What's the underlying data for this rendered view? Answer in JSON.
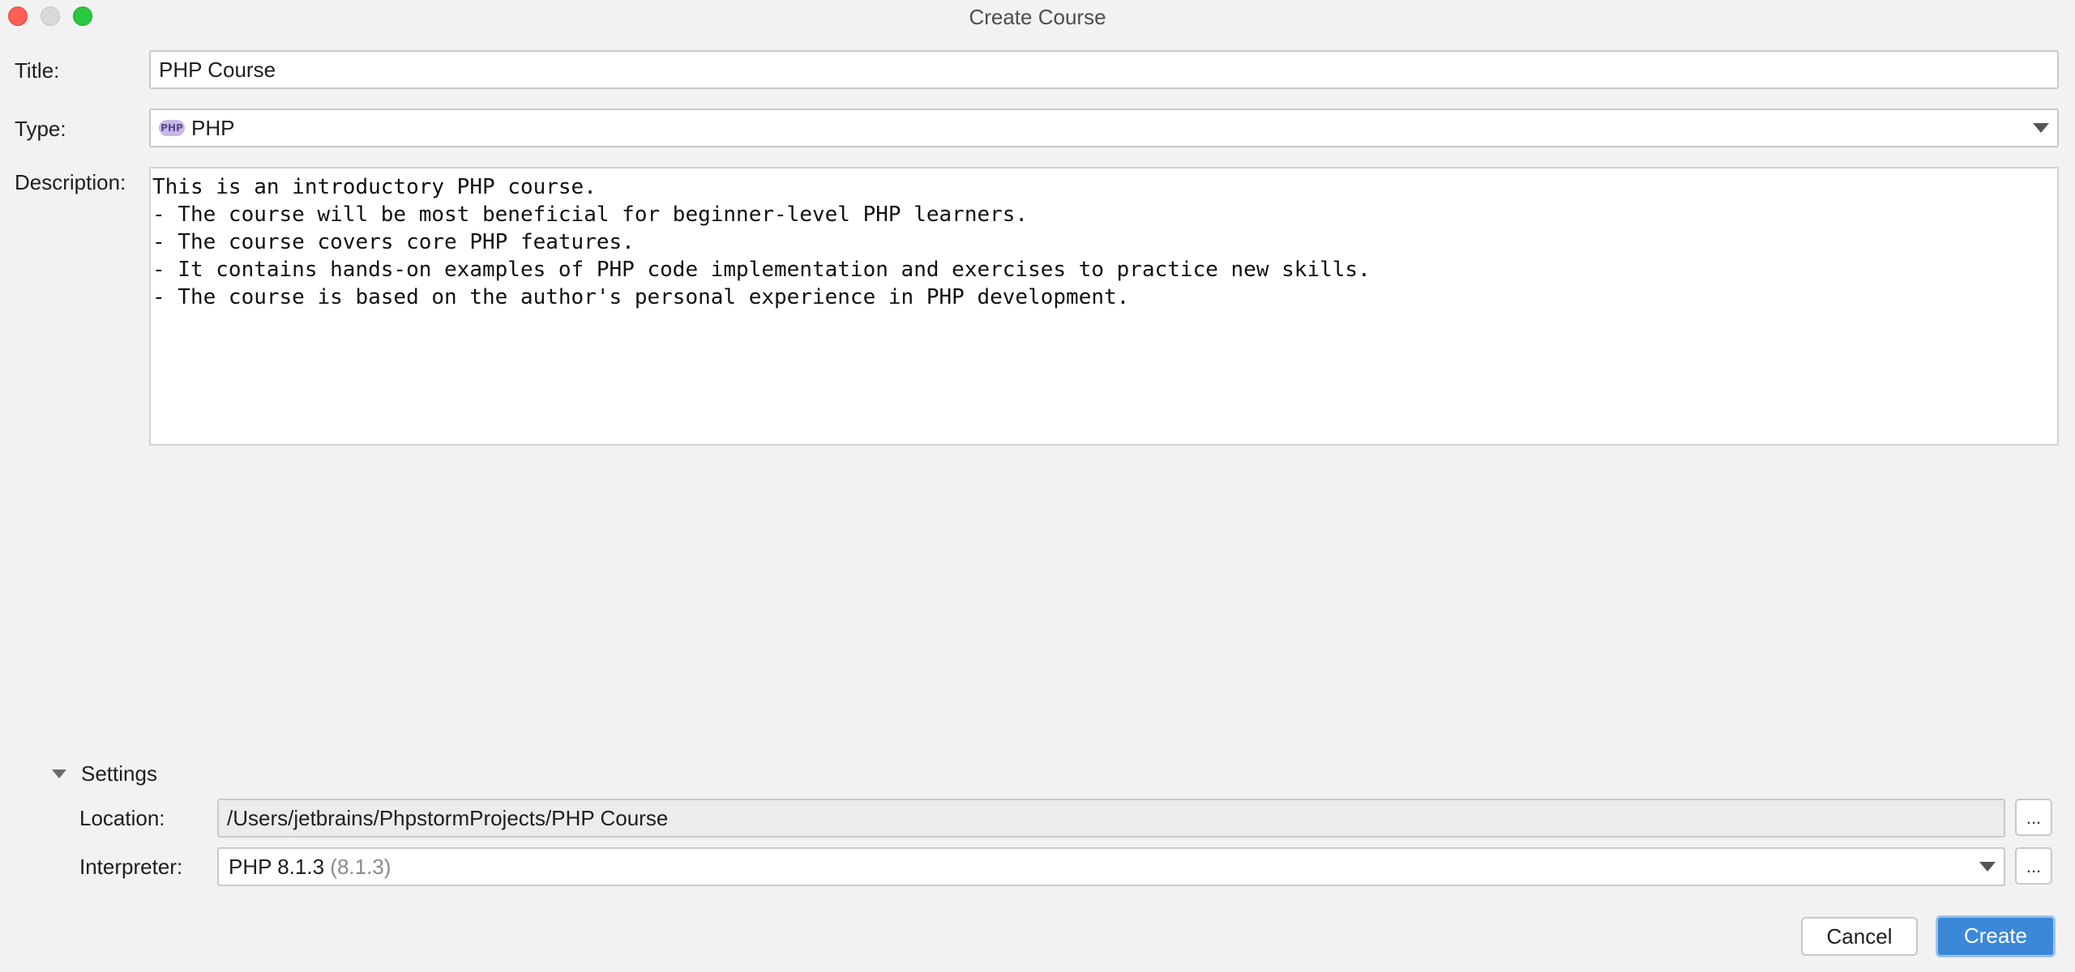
{
  "window": {
    "title": "Create Course"
  },
  "form": {
    "title_label": "Title:",
    "title_value": "PHP Course",
    "type_label": "Type:",
    "type_badge": "PHP",
    "type_value": "PHP",
    "description_label": "Description:",
    "description_value": "This is an introductory PHP course.\n- The course will be most beneficial for beginner-level PHP learners.\n- The course covers core PHP features.\n- It contains hands-on examples of PHP code implementation and exercises to practice new skills.\n- The course is based on the author's personal experience in PHP development."
  },
  "settings": {
    "toggle_label": "Settings",
    "expanded": true,
    "location_label": "Location:",
    "location_value": "/Users/jetbrains/PhpstormProjects/PHP Course",
    "location_browse": "...",
    "interpreter_label": "Interpreter:",
    "interpreter_value": "PHP 8.1.3",
    "interpreter_version": "(8.1.3)",
    "interpreter_browse": "..."
  },
  "buttons": {
    "cancel": "Cancel",
    "create": "Create"
  },
  "icons": {
    "close": "window-close-icon",
    "minimize": "window-minimize-icon",
    "maximize": "window-maximize-icon",
    "php": "php-icon",
    "dropdown": "chevron-down-icon",
    "expand": "triangle-down-icon"
  },
  "colors": {
    "accent": "#3b88d8",
    "close": "#fe5f57",
    "maximize": "#28c840",
    "php_badge": "#c8b8e8"
  }
}
